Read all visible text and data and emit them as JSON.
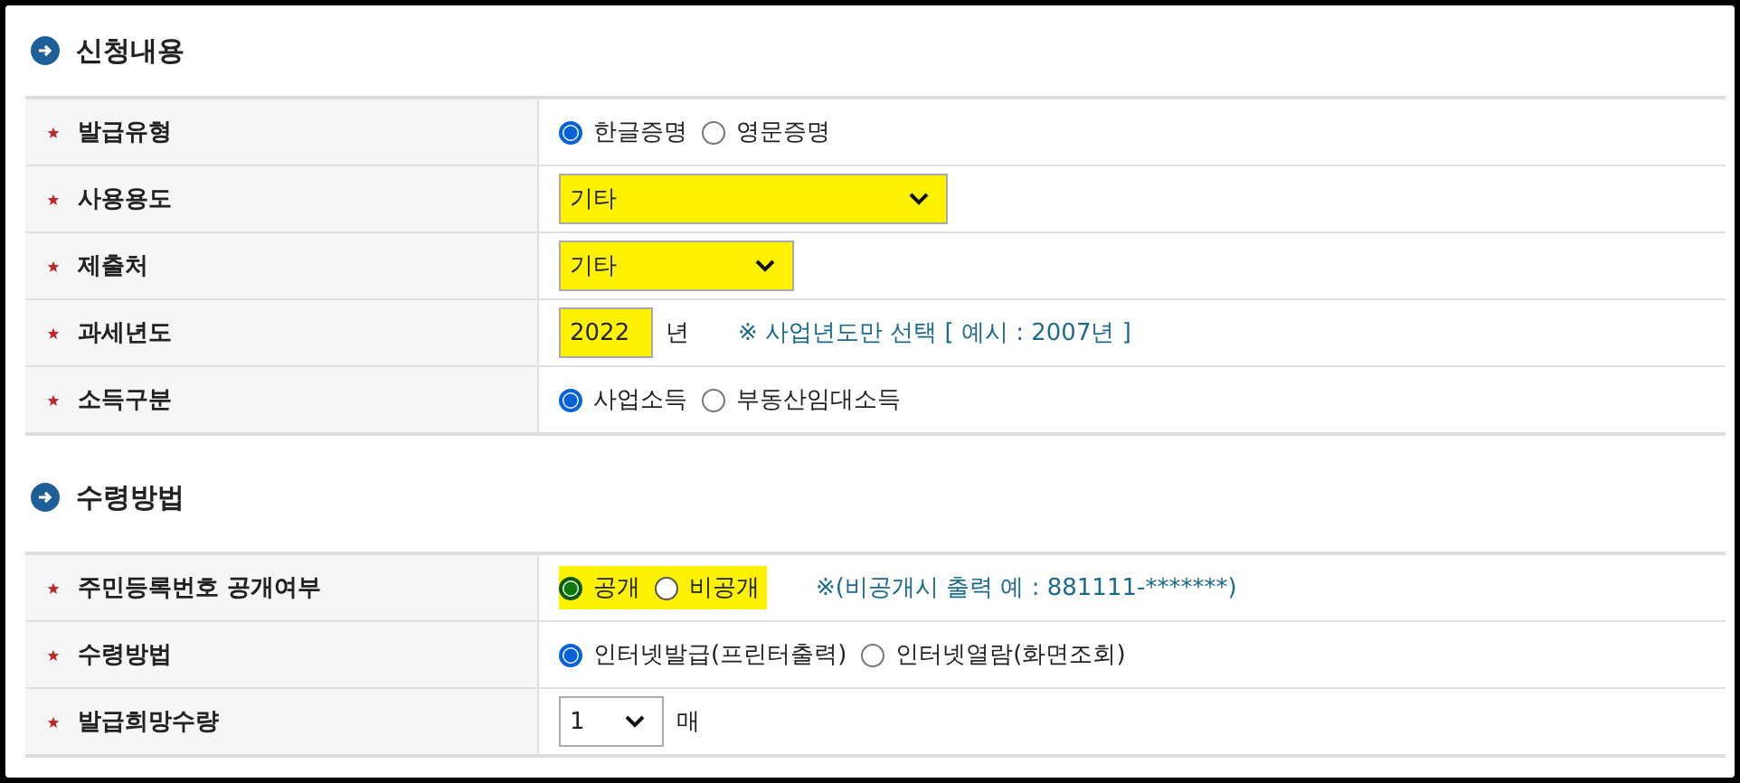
{
  "sections": [
    {
      "title": "신청내용",
      "rows": [
        {
          "label": "발급유형",
          "required": true,
          "highlighted": false,
          "kind": "radio",
          "options": [
            {
              "label": "한글증명",
              "selected": true
            },
            {
              "label": "영문증명",
              "selected": false
            }
          ]
        },
        {
          "label": "사용용도",
          "required": true,
          "highlighted": true,
          "kind": "select",
          "value": "기타"
        },
        {
          "label": "제출처",
          "required": true,
          "highlighted": true,
          "kind": "select",
          "value": "기타"
        },
        {
          "label": "과세년도",
          "required": true,
          "highlighted": true,
          "kind": "input",
          "value": "2022",
          "suffix": "년",
          "note": "※ 사업년도만 선택 [ 예시 : 2007년 ]"
        },
        {
          "label": "소득구분",
          "required": true,
          "highlighted": false,
          "kind": "radio",
          "options": [
            {
              "label": "사업소득",
              "selected": true
            },
            {
              "label": "부동산임대소득",
              "selected": false
            }
          ]
        }
      ]
    },
    {
      "title": "수령방법",
      "rows": [
        {
          "label": "주민등록번호 공개여부",
          "required": true,
          "highlighted": true,
          "kind": "radio",
          "options": [
            {
              "label": "공개",
              "selected": true
            },
            {
              "label": "비공개",
              "selected": false
            }
          ],
          "note": "※(비공개시 출력 예 : 881111-*******)"
        },
        {
          "label": "수령방법",
          "required": true,
          "highlighted": false,
          "kind": "radio",
          "options": [
            {
              "label": "인터넷발급(프린터출력)",
              "selected": true
            },
            {
              "label": "인터넷열람(화면조회)",
              "selected": false
            }
          ]
        },
        {
          "label": "발급희망수량",
          "required": true,
          "highlighted": false,
          "kind": "select",
          "value": "1",
          "suffix": "매"
        }
      ]
    }
  ]
}
